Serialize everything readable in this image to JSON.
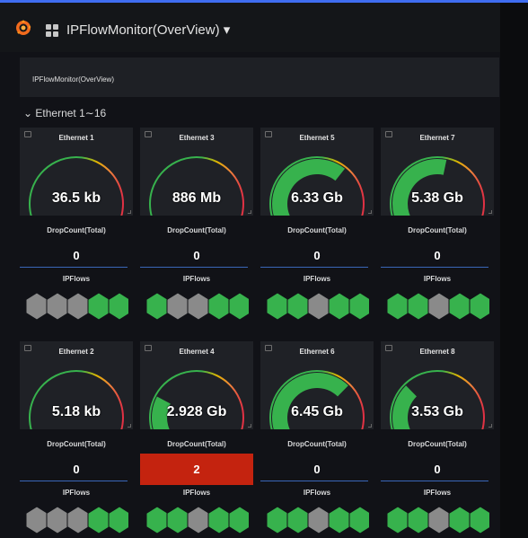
{
  "header": {
    "logo_icon": "grafana-logo-icon",
    "apps_icon": "dashboard-grid-icon",
    "dashboard_title": "IPFlowMonitor(OverView) ▾"
  },
  "info_panel": {
    "text": "IPFlowMonitor(OverView)"
  },
  "row": {
    "title": "⌄ Ethernet 1∼16"
  },
  "colors": {
    "green": "#37b24d",
    "grey": "#8a8a8a",
    "red_alert": "#c4230f",
    "panel_bg": "#1f2126",
    "page_bg": "#111217"
  },
  "labels": {
    "drop": "DropCount(Total)",
    "flows": "IPFlows"
  },
  "ports": [
    {
      "title": "Ethernet 1",
      "value": "36.5 kb",
      "gauge_fraction": 0.01,
      "drop": "0",
      "drop_alert": false,
      "flows": [
        "grey",
        "grey",
        "grey",
        "green",
        "green"
      ]
    },
    {
      "title": "Ethernet 3",
      "value": "886 Mb",
      "gauge_fraction": 0.09,
      "drop": "0",
      "drop_alert": false,
      "flows": [
        "green",
        "grey",
        "grey",
        "green",
        "green"
      ]
    },
    {
      "title": "Ethernet 5",
      "value": "6.33 Gb",
      "gauge_fraction": 0.63,
      "drop": "0",
      "drop_alert": false,
      "flows": [
        "green",
        "green",
        "grey",
        "green",
        "green"
      ]
    },
    {
      "title": "Ethernet 7",
      "value": "5.38 Gb",
      "gauge_fraction": 0.54,
      "drop": "0",
      "drop_alert": false,
      "flows": [
        "green",
        "green",
        "grey",
        "green",
        "green"
      ]
    },
    {
      "title": "Ethernet 2",
      "value": "5.18 kb",
      "gauge_fraction": 0.01,
      "drop": "0",
      "drop_alert": false,
      "flows": [
        "grey",
        "grey",
        "grey",
        "green",
        "green"
      ]
    },
    {
      "title": "Ethernet 4",
      "value": "2.928 Gb",
      "gauge_fraction": 0.29,
      "drop": "2",
      "drop_alert": true,
      "flows": [
        "green",
        "green",
        "grey",
        "green",
        "green"
      ]
    },
    {
      "title": "Ethernet 6",
      "value": "6.45 Gb",
      "gauge_fraction": 0.65,
      "drop": "0",
      "drop_alert": false,
      "flows": [
        "green",
        "green",
        "grey",
        "green",
        "green"
      ]
    },
    {
      "title": "Ethernet 8",
      "value": "3.53 Gb",
      "gauge_fraction": 0.35,
      "drop": "0",
      "drop_alert": false,
      "flows": [
        "green",
        "green",
        "grey",
        "green",
        "green"
      ]
    }
  ]
}
